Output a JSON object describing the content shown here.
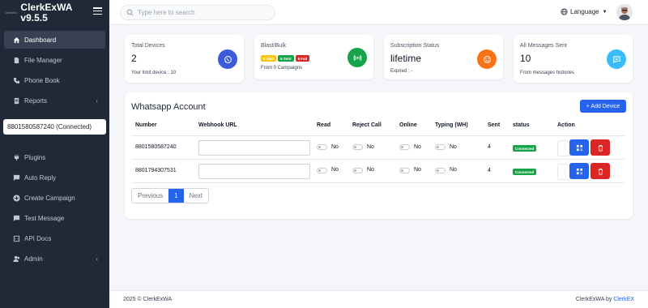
{
  "brand": {
    "logo_text": "ClerkEx",
    "title_line1": "ClerkExWA",
    "title_line2": "v9.5.5"
  },
  "sidebar": {
    "items_top": [
      {
        "label": "Dashboard",
        "icon": "home-icon",
        "active": true
      },
      {
        "label": "File Manager",
        "icon": "file-icon"
      },
      {
        "label": "Phone Book",
        "icon": "phone-icon"
      },
      {
        "label": "Reports",
        "icon": "report-icon",
        "has_chevron": true
      }
    ],
    "device_select": "8801580587240 (Connected)",
    "items_bottom": [
      {
        "label": "Plugins",
        "icon": "plug-icon"
      },
      {
        "label": "Auto Reply",
        "icon": "chat-icon"
      },
      {
        "label": "Create Campaign",
        "icon": "plus-circle-icon"
      },
      {
        "label": "Test Message",
        "icon": "message-icon"
      },
      {
        "label": "API Docs",
        "icon": "code-icon"
      },
      {
        "label": "Admin",
        "icon": "users-icon",
        "has_chevron": true
      }
    ]
  },
  "topbar": {
    "search_placeholder": "Type here to search",
    "language": "Language"
  },
  "stats": [
    {
      "title": "Total Devices",
      "value": "2",
      "sub": "Your limit device : 10",
      "icon": "whatsapp-icon",
      "color": "#3b5bdb"
    },
    {
      "title": "Blast/Bulk",
      "badges": [
        {
          "text": "0 Wait",
          "color": "#f5c518"
        },
        {
          "text": "6 Sent",
          "color": "#16a34a"
        },
        {
          "text": "8 Fail",
          "color": "#dc2626"
        }
      ],
      "sub": "From 0 Campaigns",
      "icon": "broadcast-icon",
      "color": "#16a34a"
    },
    {
      "title": "Subscription Status",
      "value": "lifetime",
      "sub": "Expired : -",
      "icon": "smile-icon",
      "color": "#f97316"
    },
    {
      "title": "All Messages Sent",
      "value": "10",
      "sub": "From messages histories",
      "icon": "message-icon",
      "color": "#38bdf8"
    }
  ],
  "wa": {
    "title": "Whatsapp Account",
    "add_label": "+ Add Device",
    "columns": [
      "Number",
      "Webhook URL",
      "Read",
      "Reject Call",
      "Online",
      "Typing (WH)",
      "Sent",
      "status",
      "Action"
    ],
    "rows": [
      {
        "number": "8801580587240",
        "read": "No",
        "reject": "No",
        "online": "No",
        "typing": "No",
        "sent": "4",
        "status": "Connected"
      },
      {
        "number": "8801794307531",
        "read": "No",
        "reject": "No",
        "online": "No",
        "typing": "No",
        "sent": "4",
        "status": "Connected"
      }
    ],
    "pager": {
      "prev": "Previous",
      "page": "1",
      "next": "Next"
    }
  },
  "footer": {
    "left": "2025 © ClerkExWA",
    "right_prefix": "ClerkExWA by ",
    "right_link": "ClerkEX"
  },
  "colors": {
    "sidebar_bg": "#1f2937",
    "primary": "#2563eb",
    "danger": "#dc2626",
    "success": "#16a34a"
  }
}
